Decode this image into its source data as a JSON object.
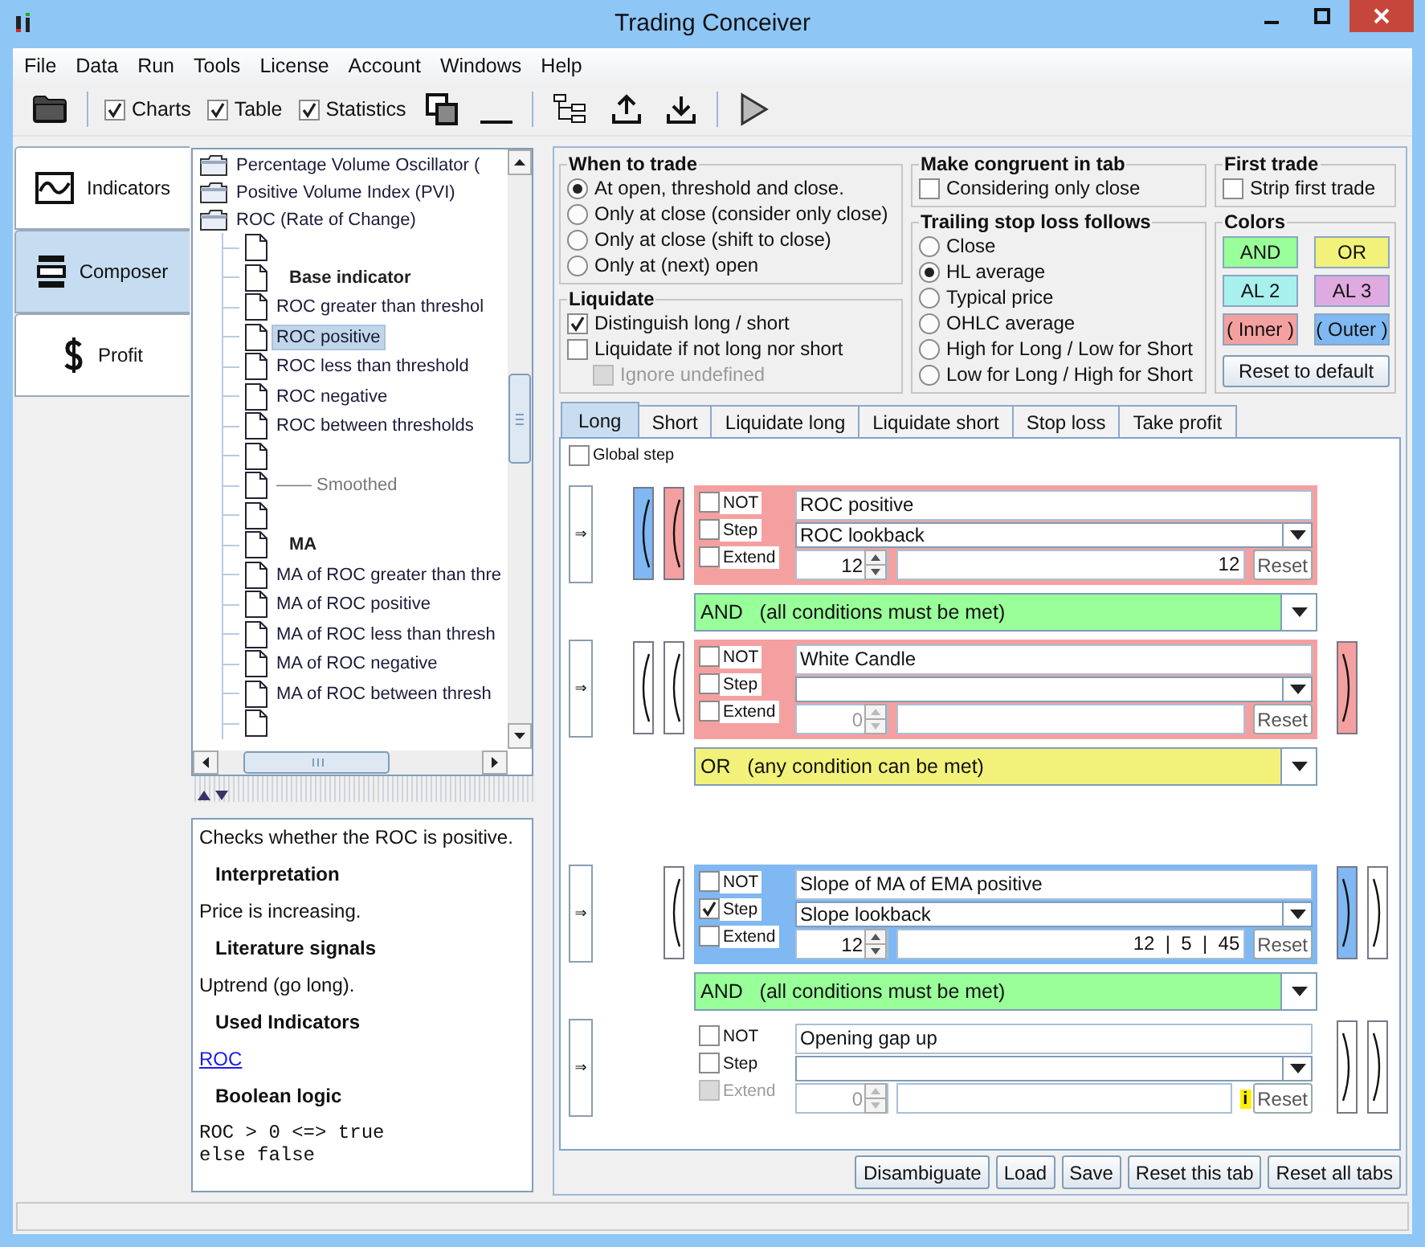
{
  "window": {
    "title": "Trading Conceiver"
  },
  "menu": [
    "File",
    "Data",
    "Run",
    "Tools",
    "License",
    "Account",
    "Windows",
    "Help"
  ],
  "toolbar": {
    "checkboxes": [
      {
        "label": "Charts",
        "checked": true
      },
      {
        "label": "Table",
        "checked": true
      },
      {
        "label": "Statistics",
        "checked": true
      }
    ]
  },
  "side_tabs": [
    {
      "label": "Indicators",
      "selected": false
    },
    {
      "label": "Composer",
      "selected": true
    },
    {
      "label": "Profit",
      "selected": false
    }
  ],
  "tree": {
    "items": [
      {
        "kind": "folder",
        "label": "Percentage Volume Oscillator (",
        "selected": false
      },
      {
        "kind": "folder",
        "label": "Positive Volume Index (PVI)",
        "selected": false
      },
      {
        "kind": "folder",
        "label": "ROC (Rate of Change)",
        "selected": false,
        "children": [
          {
            "kind": "blank",
            "selected": false
          },
          {
            "kind": "header",
            "label": "Base indicator",
            "selected": false
          },
          {
            "kind": "leaf",
            "label": "ROC greater than threshol",
            "selected": false
          },
          {
            "kind": "leaf",
            "label": "ROC positive",
            "selected": true
          },
          {
            "kind": "leaf",
            "label": "ROC less than threshold",
            "selected": false
          },
          {
            "kind": "leaf",
            "label": "ROC negative",
            "selected": false
          },
          {
            "kind": "leaf",
            "label": "ROC between thresholds",
            "selected": false
          },
          {
            "kind": "blank",
            "selected": false
          },
          {
            "kind": "separator",
            "label": "—— Smoothed",
            "selected": false
          },
          {
            "kind": "blank",
            "selected": false
          },
          {
            "kind": "header",
            "label": "MA",
            "selected": false
          },
          {
            "kind": "leaf",
            "label": "MA of ROC greater than thre",
            "selected": false
          },
          {
            "kind": "leaf",
            "label": "MA of ROC positive",
            "selected": false
          },
          {
            "kind": "leaf",
            "label": "MA of ROC less than thresh",
            "selected": false
          },
          {
            "kind": "leaf",
            "label": "MA of ROC negative",
            "selected": false
          },
          {
            "kind": "leaf",
            "label": "MA of ROC between thresh",
            "selected": false
          },
          {
            "kind": "blank",
            "selected": false
          }
        ]
      }
    ]
  },
  "description": [
    {
      "kind": "text",
      "text": "Checks whether the ROC is positive."
    },
    {
      "kind": "heading",
      "text": "Interpretation"
    },
    {
      "kind": "text",
      "text": "Price is increasing."
    },
    {
      "kind": "heading",
      "text": "Literature signals"
    },
    {
      "kind": "text",
      "text": "Uptrend (go long)."
    },
    {
      "kind": "heading",
      "text": "Used Indicators"
    },
    {
      "kind": "link",
      "text": "ROC"
    },
    {
      "kind": "heading",
      "text": "Boolean logic"
    },
    {
      "kind": "code",
      "text": "ROC > 0 <=> true\nelse false"
    }
  ],
  "when_to_trade": {
    "title": "When to trade",
    "options": [
      {
        "label": "At open, threshold and close.",
        "selected": true
      },
      {
        "label": "Only at close (consider only close)",
        "selected": false
      },
      {
        "label": "Only at close (shift to close)",
        "selected": false
      },
      {
        "label": "Only at (next) open",
        "selected": false
      }
    ]
  },
  "liquidate": {
    "title": "Liquidate",
    "options": [
      {
        "label": "Distinguish long / short",
        "checked": true,
        "disabled": false
      },
      {
        "label": "Liquidate if not long nor short",
        "checked": false,
        "disabled": false,
        "children": [
          {
            "label": "Ignore undefined",
            "checked": false,
            "disabled": true
          }
        ]
      }
    ]
  },
  "congruent": {
    "title": "Make congruent in tab",
    "options": [
      {
        "label": "Considering only close",
        "checked": false
      }
    ]
  },
  "trailing_stop": {
    "title": "Trailing stop loss follows",
    "options": [
      {
        "label": "Close",
        "selected": false
      },
      {
        "label": "HL average",
        "selected": true
      },
      {
        "label": "Typical price",
        "selected": false
      },
      {
        "label": "OHLC average",
        "selected": false
      },
      {
        "label": "High for Long / Low for Short",
        "selected": false
      },
      {
        "label": "Low for Long / High for Short",
        "selected": false
      }
    ]
  },
  "first_trade": {
    "title": "First trade",
    "options": [
      {
        "label": "Strip first trade",
        "checked": false
      }
    ]
  },
  "colors": {
    "title": "Colors",
    "swatches": [
      {
        "label": "AND",
        "color": "#99ff99"
      },
      {
        "label": "OR",
        "color": "#f2f27a"
      },
      {
        "label": "AL 2",
        "color": "#a8f0ee"
      },
      {
        "label": "AL 3",
        "color": "#dfaadf"
      },
      {
        "label": "( Inner )",
        "color": "#f5a0a0"
      },
      {
        "label": "( Outer )",
        "color": "#7fb8f2"
      }
    ],
    "reset": "Reset to default"
  },
  "tabs": [
    {
      "label": "Long",
      "selected": true
    },
    {
      "label": "Short",
      "selected": false
    },
    {
      "label": "Liquidate long",
      "selected": false
    },
    {
      "label": "Liquidate short",
      "selected": false
    },
    {
      "label": "Stop loss",
      "selected": false
    },
    {
      "label": "Take profit",
      "selected": false
    }
  ],
  "global_step": {
    "label": "Global step",
    "checked": false
  },
  "rows": [
    {
      "kind": "condition",
      "arrow": "⇒",
      "color": "#f5a0a0",
      "open_parens": [
        {
          "color": "#7fb8f2"
        },
        {
          "color": "#f5a0a0"
        }
      ],
      "close_parens": [],
      "checks": [
        {
          "label": "NOT",
          "checked": false,
          "disabled": false
        },
        {
          "label": "Step",
          "checked": false,
          "disabled": false
        },
        {
          "label": "Extend",
          "checked": false,
          "disabled": false
        }
      ],
      "name": "ROC positive",
      "parameter": "ROC lookback",
      "spinner": {
        "value": "12",
        "disabled": false
      },
      "range": "12",
      "reset": "Reset"
    },
    {
      "kind": "connector",
      "label": "AND   (all conditions must be met)",
      "color": "#99ff99"
    },
    {
      "kind": "condition",
      "arrow": "⇒",
      "color": "#f5a0a0",
      "open_parens": [
        {
          "color": "#ffffff"
        },
        {
          "color": "#ffffff"
        }
      ],
      "close_parens": [
        {
          "color": "#f5a0a0"
        }
      ],
      "checks": [
        {
          "label": "NOT",
          "checked": false,
          "disabled": false
        },
        {
          "label": "Step",
          "checked": false,
          "disabled": false
        },
        {
          "label": "Extend",
          "checked": false,
          "disabled": false
        }
      ],
      "name": "White Candle",
      "spinner": {
        "value": "0",
        "disabled": true
      },
      "reset": "Reset"
    },
    {
      "kind": "connector",
      "label": "OR   (any condition can be met)",
      "color": "#f2f27a"
    },
    {
      "kind": "condition",
      "arrow": "⇒",
      "color": "#7fb8f2",
      "open_parens": [
        {
          "color": "#ffffff"
        }
      ],
      "close_parens": [
        {
          "color": "#7fb8f2"
        },
        {
          "color": "#ffffff"
        }
      ],
      "checks": [
        {
          "label": "NOT",
          "checked": false,
          "disabled": false
        },
        {
          "label": "Step",
          "checked": true,
          "disabled": false
        },
        {
          "label": "Extend",
          "checked": false,
          "disabled": false
        }
      ],
      "name": "Slope of MA of EMA positive",
      "parameter": "Slope lookback",
      "spinner": {
        "value": "12",
        "disabled": false
      },
      "range": "12  |  5  |  45",
      "reset": "Reset"
    },
    {
      "kind": "connector",
      "label": "AND   (all conditions must be met)",
      "color": "#99ff99"
    },
    {
      "kind": "condition",
      "arrow": "⇒",
      "open_parens": [],
      "close_parens": [
        {
          "color": "#ffffff"
        },
        {
          "color": "#ffffff"
        }
      ],
      "checks": [
        {
          "label": "NOT",
          "checked": false,
          "disabled": false
        },
        {
          "label": "Step",
          "checked": false,
          "disabled": false
        },
        {
          "label": "Extend",
          "checked": false,
          "disabled": true
        }
      ],
      "name": "Opening gap up",
      "spinner": {
        "value": "0",
        "disabled": true
      },
      "info": "i",
      "reset": "Reset"
    }
  ],
  "buttons": [
    "Disambiguate",
    "Load",
    "Save",
    "Reset this tab",
    "Reset all tabs"
  ]
}
